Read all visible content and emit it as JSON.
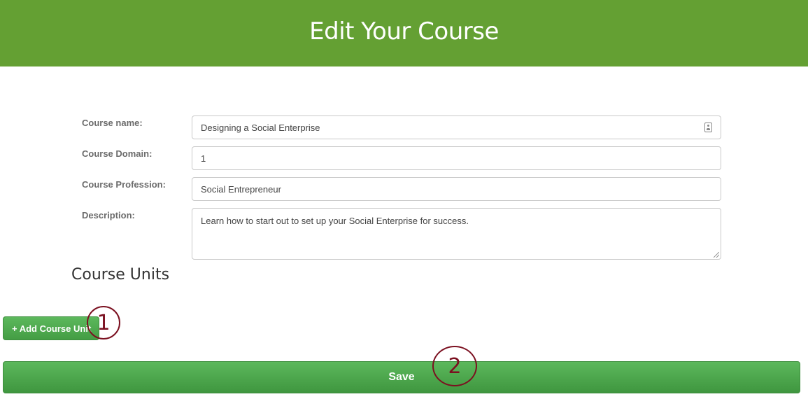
{
  "header": {
    "title": "Edit Your Course"
  },
  "form": {
    "course_name": {
      "label": "Course name:",
      "value": "Designing a Social Enterprise"
    },
    "course_domain": {
      "label": "Course Domain:",
      "value": "1"
    },
    "course_profession": {
      "label": "Course Profession:",
      "value": "Social Entrepreneur"
    },
    "description": {
      "label": "Description:",
      "value": "Learn how to start out to set up your Social Enterprise for success."
    }
  },
  "units": {
    "title": "Course Units",
    "add_label": "+ Add Course Unit"
  },
  "save_label": "Save",
  "annotations": {
    "marker_1": "1",
    "marker_2": "2"
  },
  "colors": {
    "header_bg": "#64a033",
    "button_green": "#5cb85c",
    "marker": "#7b1020"
  },
  "icons": {
    "course_name_field": "contact-card-icon"
  }
}
